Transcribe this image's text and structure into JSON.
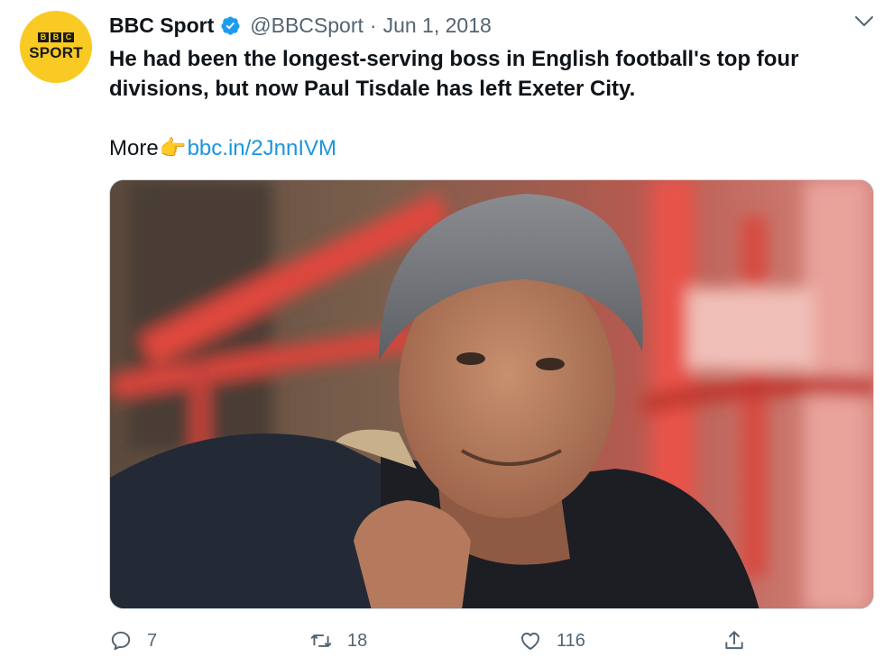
{
  "account": {
    "display_name": "BBC Sport",
    "handle": "@BBCSport",
    "separator": "·",
    "date": "Jun 1, 2018",
    "verified": true,
    "avatar": {
      "logo_letters": [
        "B",
        "B",
        "C"
      ],
      "logo_word": "SPORT",
      "background_color": "#f9c924"
    }
  },
  "tweet": {
    "text": "He had been the longest-serving boss in English football's top four divisions, but now Paul Tisdale has left Exeter City.",
    "more_word": "More",
    "emoji_icon": "backhand-pointing-right-icon",
    "link_text": "bbc.in/2JnnIVM",
    "link_color": "#1b95e0"
  },
  "media": {
    "kind": "photo",
    "subject_icon": "man-in-grey-beanie-photo"
  },
  "actions": {
    "reply_count": "7",
    "retweet_count": "18",
    "like_count": "116"
  },
  "colors": {
    "text_primary": "#0f1419",
    "text_secondary": "#536471",
    "verified_blue": "#1d9bf0"
  }
}
